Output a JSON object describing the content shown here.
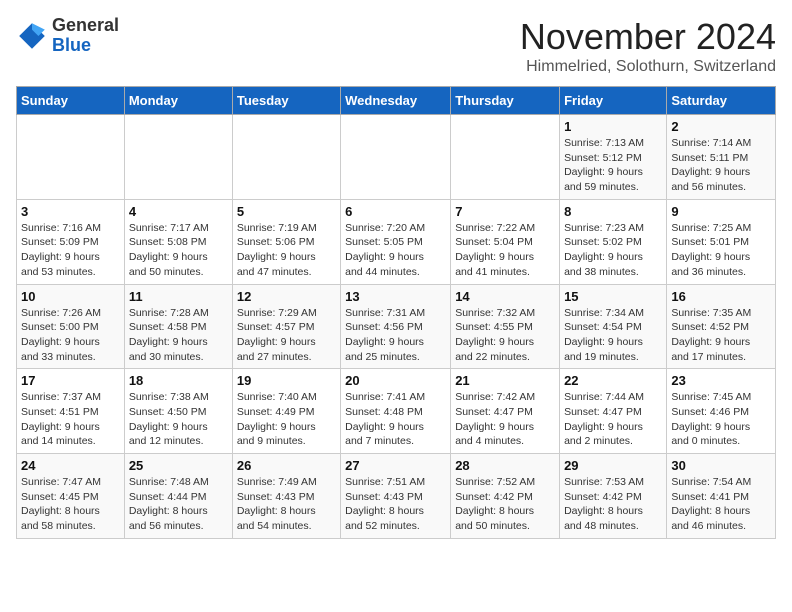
{
  "header": {
    "logo_general": "General",
    "logo_blue": "Blue",
    "month_title": "November 2024",
    "location": "Himmelried, Solothurn, Switzerland"
  },
  "weekdays": [
    "Sunday",
    "Monday",
    "Tuesday",
    "Wednesday",
    "Thursday",
    "Friday",
    "Saturday"
  ],
  "weeks": [
    [
      {
        "day": "",
        "detail": ""
      },
      {
        "day": "",
        "detail": ""
      },
      {
        "day": "",
        "detail": ""
      },
      {
        "day": "",
        "detail": ""
      },
      {
        "day": "",
        "detail": ""
      },
      {
        "day": "1",
        "detail": "Sunrise: 7:13 AM\nSunset: 5:12 PM\nDaylight: 9 hours\nand 59 minutes."
      },
      {
        "day": "2",
        "detail": "Sunrise: 7:14 AM\nSunset: 5:11 PM\nDaylight: 9 hours\nand 56 minutes."
      }
    ],
    [
      {
        "day": "3",
        "detail": "Sunrise: 7:16 AM\nSunset: 5:09 PM\nDaylight: 9 hours\nand 53 minutes."
      },
      {
        "day": "4",
        "detail": "Sunrise: 7:17 AM\nSunset: 5:08 PM\nDaylight: 9 hours\nand 50 minutes."
      },
      {
        "day": "5",
        "detail": "Sunrise: 7:19 AM\nSunset: 5:06 PM\nDaylight: 9 hours\nand 47 minutes."
      },
      {
        "day": "6",
        "detail": "Sunrise: 7:20 AM\nSunset: 5:05 PM\nDaylight: 9 hours\nand 44 minutes."
      },
      {
        "day": "7",
        "detail": "Sunrise: 7:22 AM\nSunset: 5:04 PM\nDaylight: 9 hours\nand 41 minutes."
      },
      {
        "day": "8",
        "detail": "Sunrise: 7:23 AM\nSunset: 5:02 PM\nDaylight: 9 hours\nand 38 minutes."
      },
      {
        "day": "9",
        "detail": "Sunrise: 7:25 AM\nSunset: 5:01 PM\nDaylight: 9 hours\nand 36 minutes."
      }
    ],
    [
      {
        "day": "10",
        "detail": "Sunrise: 7:26 AM\nSunset: 5:00 PM\nDaylight: 9 hours\nand 33 minutes."
      },
      {
        "day": "11",
        "detail": "Sunrise: 7:28 AM\nSunset: 4:58 PM\nDaylight: 9 hours\nand 30 minutes."
      },
      {
        "day": "12",
        "detail": "Sunrise: 7:29 AM\nSunset: 4:57 PM\nDaylight: 9 hours\nand 27 minutes."
      },
      {
        "day": "13",
        "detail": "Sunrise: 7:31 AM\nSunset: 4:56 PM\nDaylight: 9 hours\nand 25 minutes."
      },
      {
        "day": "14",
        "detail": "Sunrise: 7:32 AM\nSunset: 4:55 PM\nDaylight: 9 hours\nand 22 minutes."
      },
      {
        "day": "15",
        "detail": "Sunrise: 7:34 AM\nSunset: 4:54 PM\nDaylight: 9 hours\nand 19 minutes."
      },
      {
        "day": "16",
        "detail": "Sunrise: 7:35 AM\nSunset: 4:52 PM\nDaylight: 9 hours\nand 17 minutes."
      }
    ],
    [
      {
        "day": "17",
        "detail": "Sunrise: 7:37 AM\nSunset: 4:51 PM\nDaylight: 9 hours\nand 14 minutes."
      },
      {
        "day": "18",
        "detail": "Sunrise: 7:38 AM\nSunset: 4:50 PM\nDaylight: 9 hours\nand 12 minutes."
      },
      {
        "day": "19",
        "detail": "Sunrise: 7:40 AM\nSunset: 4:49 PM\nDaylight: 9 hours\nand 9 minutes."
      },
      {
        "day": "20",
        "detail": "Sunrise: 7:41 AM\nSunset: 4:48 PM\nDaylight: 9 hours\nand 7 minutes."
      },
      {
        "day": "21",
        "detail": "Sunrise: 7:42 AM\nSunset: 4:47 PM\nDaylight: 9 hours\nand 4 minutes."
      },
      {
        "day": "22",
        "detail": "Sunrise: 7:44 AM\nSunset: 4:47 PM\nDaylight: 9 hours\nand 2 minutes."
      },
      {
        "day": "23",
        "detail": "Sunrise: 7:45 AM\nSunset: 4:46 PM\nDaylight: 9 hours\nand 0 minutes."
      }
    ],
    [
      {
        "day": "24",
        "detail": "Sunrise: 7:47 AM\nSunset: 4:45 PM\nDaylight: 8 hours\nand 58 minutes."
      },
      {
        "day": "25",
        "detail": "Sunrise: 7:48 AM\nSunset: 4:44 PM\nDaylight: 8 hours\nand 56 minutes."
      },
      {
        "day": "26",
        "detail": "Sunrise: 7:49 AM\nSunset: 4:43 PM\nDaylight: 8 hours\nand 54 minutes."
      },
      {
        "day": "27",
        "detail": "Sunrise: 7:51 AM\nSunset: 4:43 PM\nDaylight: 8 hours\nand 52 minutes."
      },
      {
        "day": "28",
        "detail": "Sunrise: 7:52 AM\nSunset: 4:42 PM\nDaylight: 8 hours\nand 50 minutes."
      },
      {
        "day": "29",
        "detail": "Sunrise: 7:53 AM\nSunset: 4:42 PM\nDaylight: 8 hours\nand 48 minutes."
      },
      {
        "day": "30",
        "detail": "Sunrise: 7:54 AM\nSunset: 4:41 PM\nDaylight: 8 hours\nand 46 minutes."
      }
    ]
  ]
}
